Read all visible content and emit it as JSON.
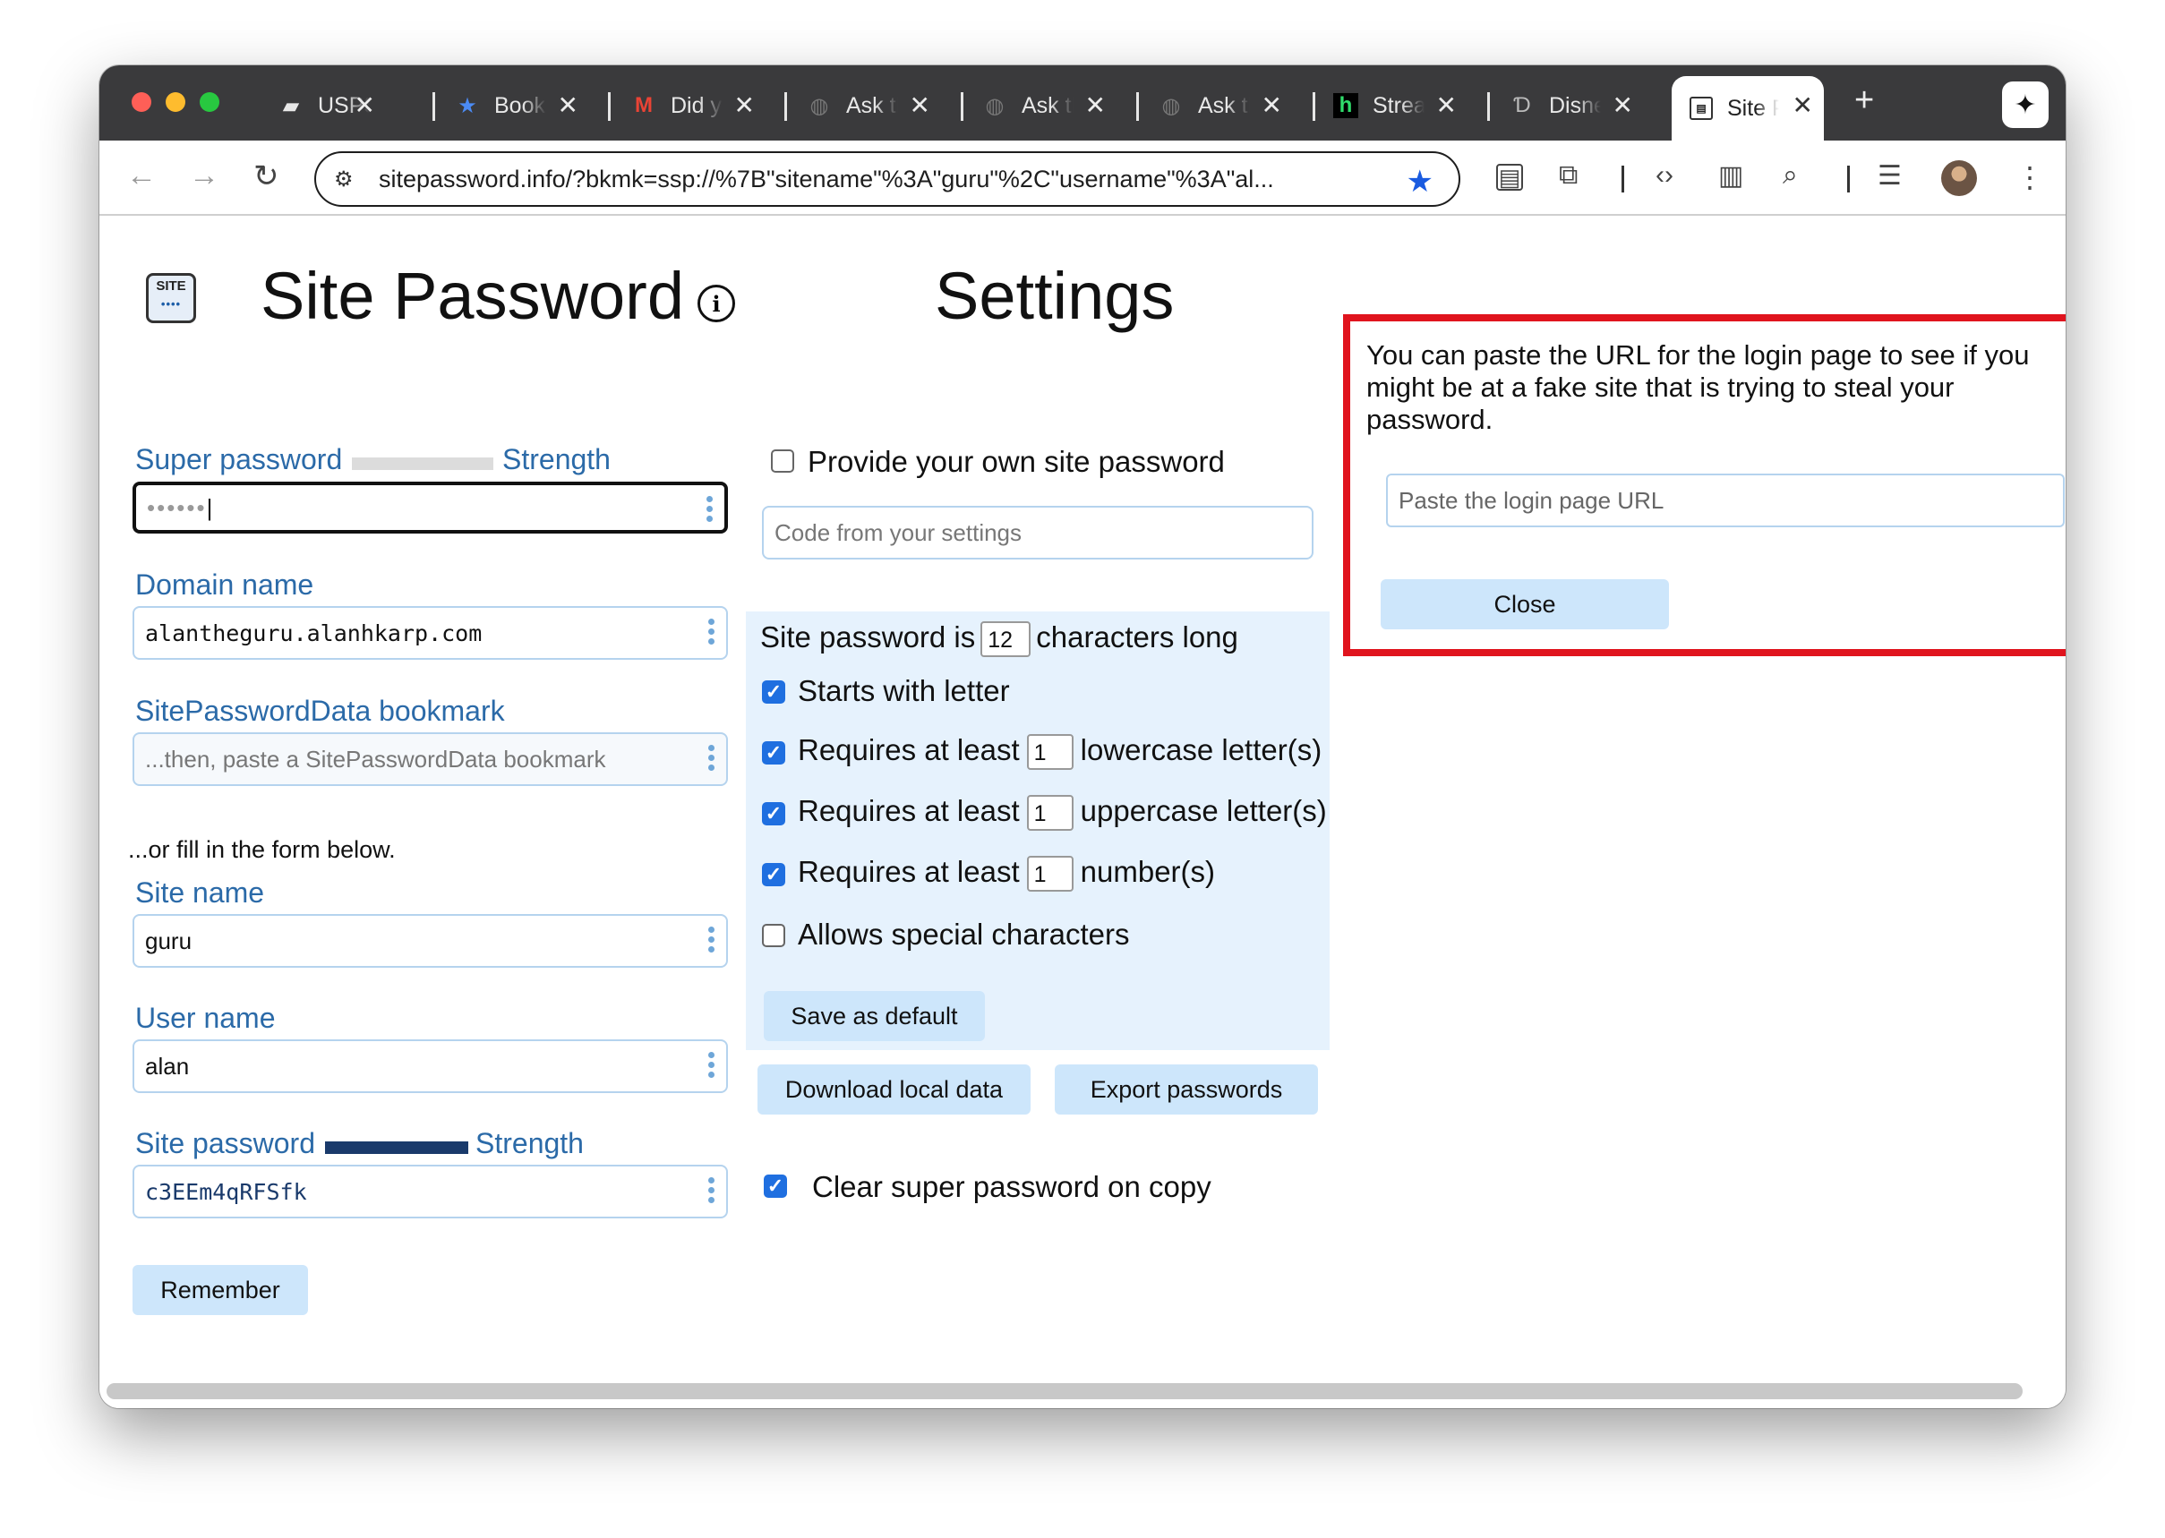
{
  "browser": {
    "tabs": [
      {
        "title": "USPS",
        "icon": "usps-eagle"
      },
      {
        "title": "Bookmarks",
        "icon": "star"
      },
      {
        "title": "Did you",
        "icon": "gmail-m"
      },
      {
        "title": "Ask the",
        "icon": "globe"
      },
      {
        "title": "Ask the",
        "icon": "globe"
      },
      {
        "title": "Ask the",
        "icon": "globe"
      },
      {
        "title": "Stream",
        "icon": "h-logo"
      },
      {
        "title": "Disney",
        "icon": "disney"
      },
      {
        "title": "Site Password",
        "icon": "site-logo"
      }
    ],
    "close_glyph": "✕",
    "new_tab_glyph": "+",
    "url": "sitepassword.info/?bkmk=ssp://%7B\"sitename\"%3A\"guru\"%2C\"username\"%3A\"al..."
  },
  "header": {
    "logo_text": "SITE",
    "logo_dots": "••••",
    "app_title": "Site Password",
    "info_glyph": "i",
    "settings_title": "Settings"
  },
  "form": {
    "super_password": {
      "label": "Super password",
      "strength_label": "Strength",
      "value": "••••••",
      "strength": 0.0
    },
    "domain": {
      "label": "Domain name",
      "value": "alantheguru.alanhkarp.com"
    },
    "bookmark": {
      "label": "SitePasswordData bookmark",
      "placeholder": "...then, paste a SitePasswordData bookmark"
    },
    "or_fill": "...or fill in the form below.",
    "site_name": {
      "label": "Site name",
      "value": "guru"
    },
    "user_name": {
      "label": "User name",
      "value": "alan"
    },
    "site_password": {
      "label": "Site password",
      "strength_label": "Strength",
      "value": "c3EEm4qRFSfk",
      "strength": 1.0
    },
    "remember_button": "Remember"
  },
  "settings": {
    "provide_own": {
      "label": "Provide your own site password",
      "checked": false
    },
    "code_placeholder": "Code from your settings",
    "length_prefix": "Site password is",
    "length_value": "12",
    "length_suffix": "characters long",
    "starts_with_letter": {
      "label": "Starts with letter",
      "checked": true
    },
    "requires_prefix": "Requires at least",
    "lowercase": {
      "min": "1",
      "label": "lowercase letter(s)",
      "checked": true
    },
    "uppercase": {
      "min": "1",
      "label": "uppercase letter(s)",
      "checked": true
    },
    "numbers": {
      "min": "1",
      "label": "number(s)",
      "checked": true
    },
    "special": {
      "label": "Allows special characters",
      "checked": false
    },
    "save_default": "Save as default",
    "download_local": "Download local data",
    "export_passwords": "Export passwords",
    "clear_on_copy": {
      "label": "Clear super password on copy",
      "checked": true
    }
  },
  "popup": {
    "message": "You can paste the URL for the login page to see if you might be at a fake site that is trying to steal your password.",
    "placeholder": "Paste the login page URL",
    "close_button": "Close"
  },
  "colors": {
    "label_blue": "#2b6aa8",
    "button_bg": "#cde6fb",
    "popup_border": "#e0141e",
    "checkbox_blue": "#1f6fe0",
    "strength_strong": "#1a3a6b"
  }
}
